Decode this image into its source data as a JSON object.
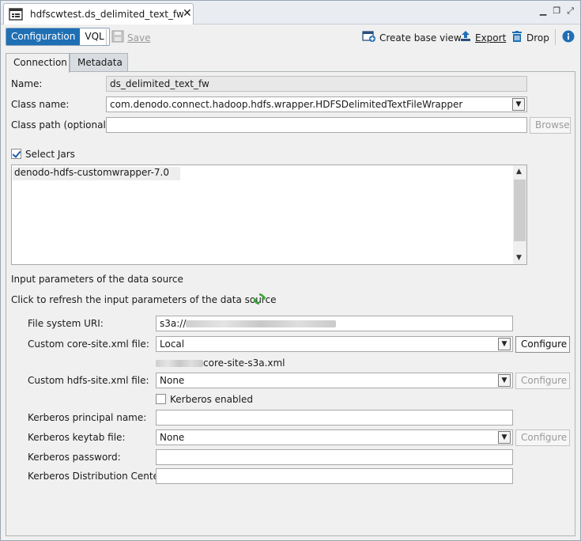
{
  "window": {
    "tab_title": "hdfscwtest.ds_delimited_text_fw"
  },
  "toolbar": {
    "configuration_label": "Configuration",
    "vql_label": "VQL",
    "save_label": "Save",
    "create_base_view_label": "Create base view",
    "export_label": "Export",
    "drop_label": "Drop"
  },
  "tabs": {
    "connection": "Connection",
    "metadata": "Metadata"
  },
  "form": {
    "name_label": "Name:",
    "name_value": "ds_delimited_text_fw",
    "class_name_label": "Class name:",
    "class_name_value": "com.denodo.connect.hadoop.hdfs.wrapper.HDFSDelimitedTextFileWrapper",
    "class_path_label": "Class path (optional):",
    "class_path_value": "",
    "browse_label": "Browse",
    "select_jars_label": "Select Jars",
    "select_jars_checked": true,
    "jars": [
      "denodo-hdfs-customwrapper-7.0"
    ]
  },
  "params": {
    "section_title": "Input parameters of the data source",
    "refresh_text": "Click to refresh the input parameters of the data source",
    "fs_uri_label": "File system URI:",
    "fs_uri_value": "s3a://",
    "core_site_label": "Custom core-site.xml file:",
    "core_site_value": "Local",
    "configure_label": "Configure",
    "core_site_file": "core-site-s3a.xml",
    "hdfs_site_label": "Custom hdfs-site.xml file:",
    "hdfs_site_value": "None",
    "kerberos_enabled_label": "Kerberos enabled",
    "kerberos_principal_label": "Kerberos principal name:",
    "kerberos_keytab_label": "Kerberos keytab file:",
    "kerberos_keytab_value": "None",
    "kerberos_password_label": "Kerberos password:",
    "kerberos_kdc_label": "Kerberos Distribution Center:"
  },
  "colors": {
    "accent": "#1f6fb4",
    "refresh_green": "#3aa635"
  }
}
